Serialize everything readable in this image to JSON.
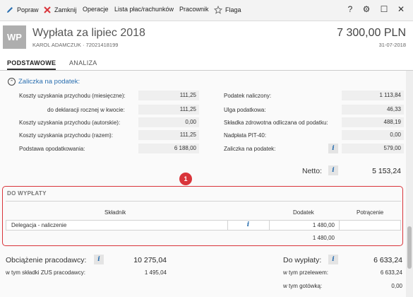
{
  "toolbar": {
    "popraw": "Popraw",
    "zamknij": "Zamknij",
    "operacje": "Operacje",
    "lista": "Lista płac/rachunków",
    "pracownik": "Pracownik",
    "flaga": "Flaga",
    "help": "?",
    "settings": "⚙",
    "maximize": "☐",
    "close": "✕"
  },
  "header": {
    "badge": "WP",
    "title": "Wypłata za lipiec 2018",
    "subtitle": "KAROL ADAMCZUK  ·  72021418199",
    "amount": "7 300,00 PLN",
    "date": "31-07-2018"
  },
  "tabs": [
    "PODSTAWOWE",
    "ANALIZA"
  ],
  "zaliczka": {
    "section_title": "Zaliczka na podatek:",
    "left": [
      {
        "label": "Koszty uzyskania przychodu (miesięczne):",
        "value": "111,25"
      },
      {
        "label": "do deklaracji rocznej w kwocie:",
        "value": "111,25"
      },
      {
        "label": "Koszty uzyskania przychodu (autorskie):",
        "value": "0,00"
      },
      {
        "label": "Koszty uzyskania przychodu (razem):",
        "value": "111,25"
      },
      {
        "label": "Podstawa opodatkowania:",
        "value": "6 188,00"
      }
    ],
    "right": [
      {
        "label": "Podatek naliczony:",
        "value": "1 113,84"
      },
      {
        "label": "Ulga podatkowa:",
        "value": "46,33"
      },
      {
        "label": "Składka zdrowotna odliczana od podatku:",
        "value": "488,19"
      },
      {
        "label": "Nadpłata PIT-40:",
        "value": "0,00"
      },
      {
        "label": "Zaliczka na podatek:",
        "value": "579,00"
      }
    ],
    "netto_label": "Netto:",
    "netto_value": "5 153,24"
  },
  "callout": "1",
  "do_wyplaty": {
    "title": "DO WYPŁATY",
    "columns": [
      "Składnik",
      "Dodatek",
      "Potrącenie"
    ],
    "rows": [
      {
        "skladnik": "Delegacja - naliczenie",
        "dodatek": "1 480,00",
        "potracenie": ""
      }
    ],
    "total_dodatek": "1 480,00"
  },
  "summary": {
    "obciazenie_label": "Obciążenie pracodawcy:",
    "obciazenie_value": "10 275,04",
    "zus_label": "w tym składki ZUS pracodawcy:",
    "zus_value": "1 495,04",
    "do_wyplaty_label": "Do wypłaty:",
    "do_wyplaty_value": "6 633,24",
    "przelewem_label": "w tym przelewem:",
    "przelewem_value": "6 633,24",
    "gotowka_label": "w tym gotówką:",
    "gotowka_value": "0,00"
  },
  "info_glyph": "i",
  "colors": {
    "accent_red": "#d9343a",
    "link_blue": "#2a6fb0"
  }
}
